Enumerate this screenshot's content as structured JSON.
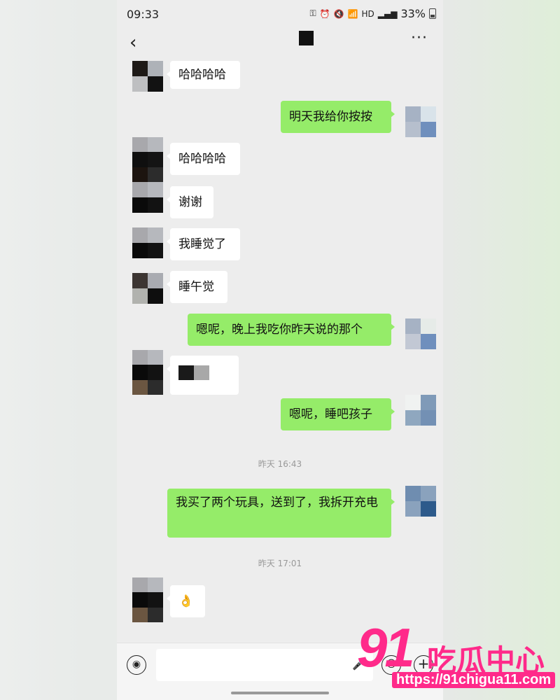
{
  "status_bar": {
    "time": "09:33",
    "battery": "33%",
    "icons": [
      "key-icon",
      "alarm-icon",
      "mute-icon",
      "wifi-icon",
      "hd-icon",
      "signal-icon",
      "battery-icon"
    ],
    "hd": "HD"
  },
  "nav": {
    "back": "‹",
    "more": "···"
  },
  "messages": [
    {
      "side": "in",
      "text": "哈哈哈哈"
    },
    {
      "side": "out",
      "text": "明天我给你按按"
    },
    {
      "side": "in",
      "text": "哈哈哈哈"
    },
    {
      "side": "in",
      "text": "谢谢"
    },
    {
      "side": "in",
      "text": "我睡觉了"
    },
    {
      "side": "in",
      "text": "睡午觉"
    },
    {
      "side": "out",
      "text": "嗯呢，晚上我吃你昨天说的那个"
    },
    {
      "side": "in",
      "text": ""
    },
    {
      "side": "out",
      "text": "嗯呢，睡吧孩子"
    },
    {
      "side": "out",
      "text": "我买了两个玩具，送到了，我拆开充电"
    },
    {
      "side": "in",
      "text": "👌"
    }
  ],
  "timestamps": [
    "昨天 16:43",
    "昨天 17:01"
  ],
  "colors": {
    "out_bubble": "#95ec69",
    "in_bubble": "#ffffff",
    "background": "#ededed",
    "watermark": "#ff2a8a"
  },
  "input_bar": {
    "voice_icon": "voice-icon",
    "emoji_icon": "emoji-icon",
    "plus_icon": "plus-icon",
    "mic_icon": "mic-icon",
    "plus": "+"
  },
  "watermark": {
    "logo": "91",
    "name": "吃瓜中心",
    "url": "https://91chigua11.com"
  }
}
